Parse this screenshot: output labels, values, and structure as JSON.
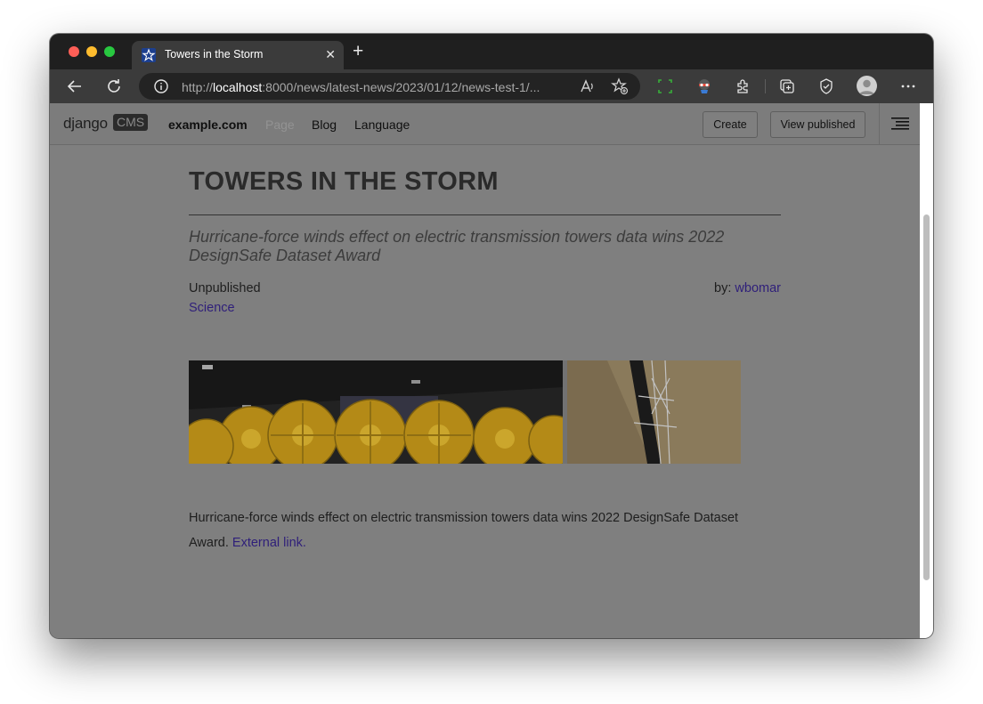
{
  "browser": {
    "tab_title": "Towers in the Storm",
    "tab_close": "✕",
    "new_tab": "+",
    "url_scheme": "http://",
    "url_host": "localhost",
    "url_rest": ":8000/news/latest-news/2023/01/12/news-test-1/...",
    "icons": [
      "back-icon",
      "reload-icon",
      "info-icon",
      "read-aloud-icon",
      "favorites-add-icon",
      "screenshot-icon",
      "extension-icon",
      "puzzle-icon",
      "collections-icon",
      "browser-essentials-icon",
      "profile-icon",
      "more-icon"
    ]
  },
  "cms_toolbar": {
    "logo_django": "django",
    "logo_cms": "CMS",
    "site": "example.com",
    "page": "Page",
    "blog": "Blog",
    "language": "Language",
    "create": "Create",
    "view_published": "View published"
  },
  "article": {
    "title": "TOWERS IN THE STORM",
    "lead": "Hurricane-force winds effect on electric transmission towers data wins 2022 DesignSafe Dataset Award",
    "status": "Unpublished",
    "by_label": "by:",
    "author": "wbomar",
    "category": "Science",
    "body": "Hurricane-force winds effect on electric transmission towers data wins 2022 DesignSafe Dataset Award.",
    "body_link": "External link."
  },
  "colors": {
    "link": "#2f1f7a",
    "overlay_gray": "#7f7f7f",
    "fan_yellow": "#d4a820"
  }
}
